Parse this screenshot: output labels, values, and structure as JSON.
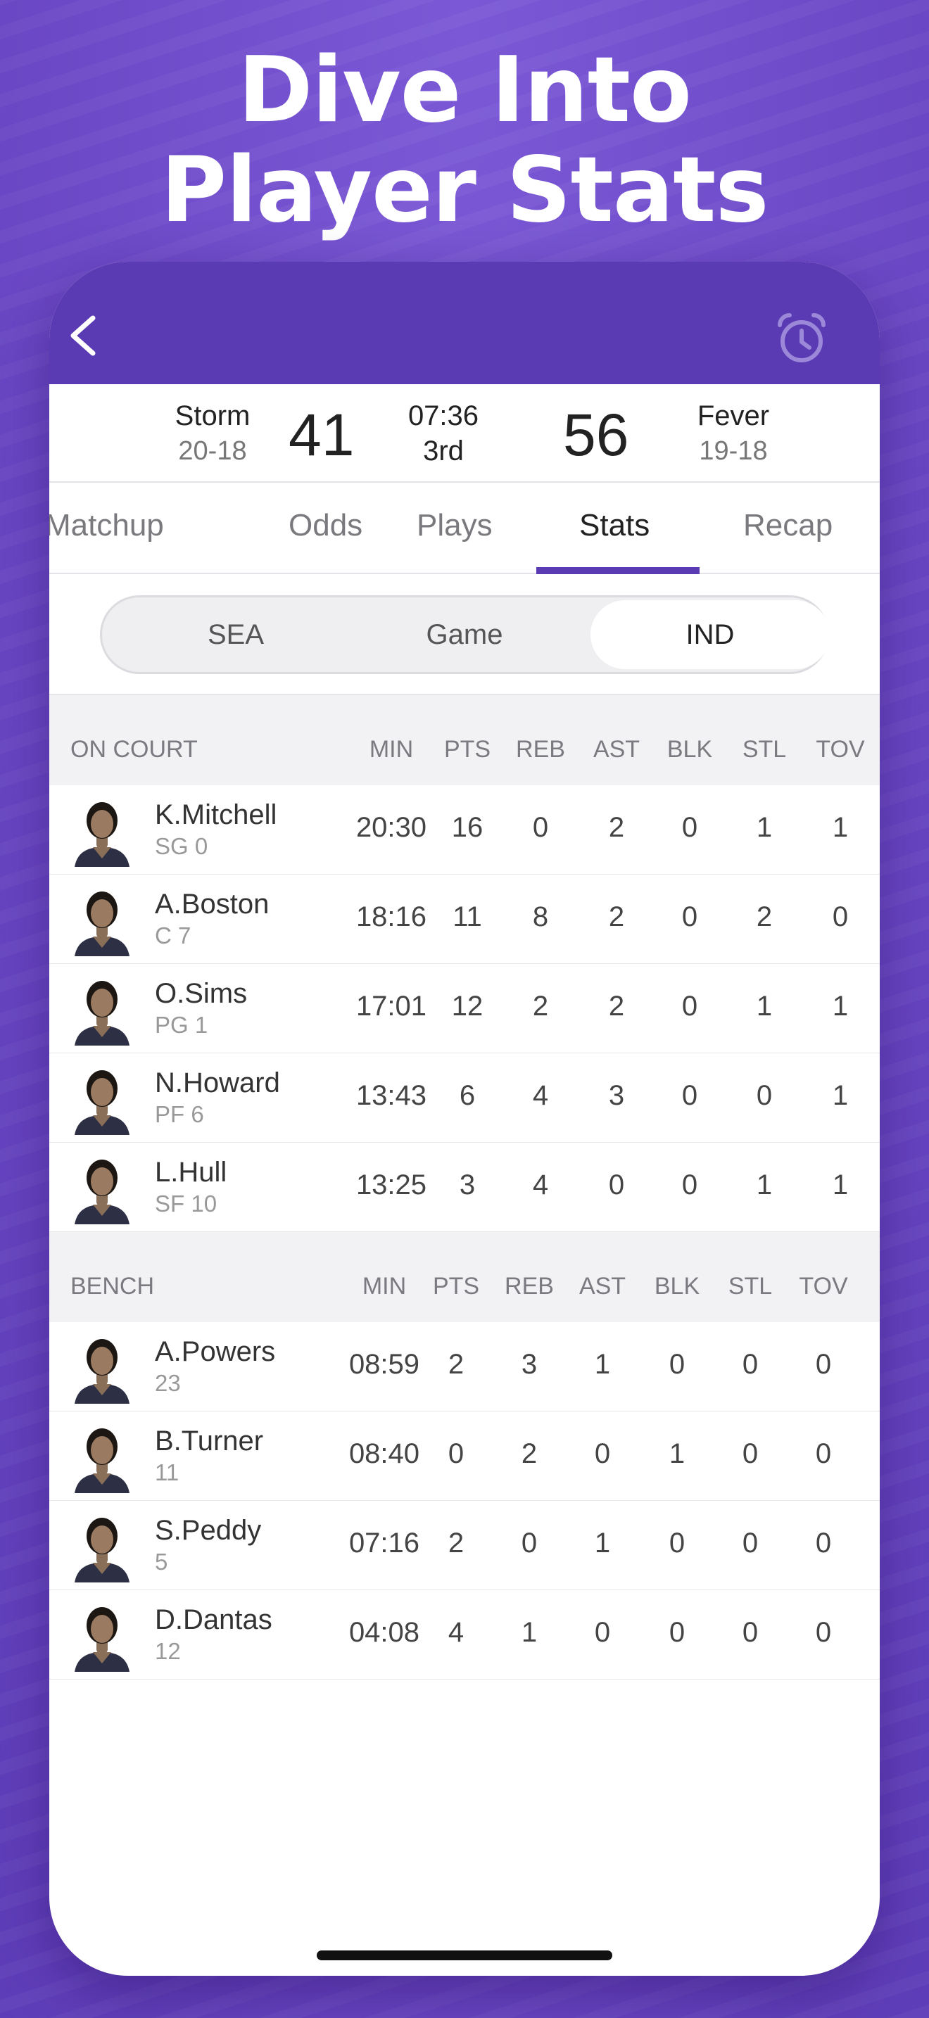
{
  "headline": {
    "line1": "Dive Into",
    "line2": "Player Stats"
  },
  "score": {
    "away_team": "Storm",
    "away_record": "20-18",
    "away_points": "41",
    "clock": "07:36",
    "period": "3rd",
    "home_points": "56",
    "home_team": "Fever",
    "home_record": "19-18"
  },
  "tabs": [
    "Matchup",
    "Odds",
    "Plays",
    "Stats",
    "Recap"
  ],
  "segment": [
    "SEA",
    "Game",
    "IND"
  ],
  "columns": [
    "MIN",
    "PTS",
    "REB",
    "AST",
    "BLK",
    "STL",
    "TOV"
  ],
  "on_court": {
    "title": "ON COURT",
    "players": [
      {
        "name": "K.Mitchell",
        "pos": "SG 0",
        "stats": [
          "20:30",
          "16",
          "0",
          "2",
          "0",
          "1",
          "1"
        ]
      },
      {
        "name": "A.Boston",
        "pos": "C 7",
        "stats": [
          "18:16",
          "11",
          "8",
          "2",
          "0",
          "2",
          "0"
        ]
      },
      {
        "name": "O.Sims",
        "pos": "PG 1",
        "stats": [
          "17:01",
          "12",
          "2",
          "2",
          "0",
          "1",
          "1"
        ]
      },
      {
        "name": "N.Howard",
        "pos": "PF 6",
        "stats": [
          "13:43",
          "6",
          "4",
          "3",
          "0",
          "0",
          "1"
        ]
      },
      {
        "name": "L.Hull",
        "pos": "SF 10",
        "stats": [
          "13:25",
          "3",
          "4",
          "0",
          "0",
          "1",
          "1"
        ]
      }
    ]
  },
  "bench": {
    "title": "BENCH",
    "players": [
      {
        "name": "A.Powers",
        "pos": "23",
        "stats": [
          "08:59",
          "2",
          "3",
          "1",
          "0",
          "0",
          "0"
        ]
      },
      {
        "name": "B.Turner",
        "pos": "11",
        "stats": [
          "08:40",
          "0",
          "2",
          "0",
          "1",
          "0",
          "0"
        ]
      },
      {
        "name": "S.Peddy",
        "pos": "5",
        "stats": [
          "07:16",
          "2",
          "0",
          "1",
          "0",
          "0",
          "0"
        ]
      },
      {
        "name": "D.Dantas",
        "pos": "12",
        "stats": [
          "04:08",
          "4",
          "1",
          "0",
          "0",
          "0",
          "0"
        ]
      }
    ]
  },
  "colors": {
    "brand_purple": "#5b3bb3",
    "background_purple": "#7250cc"
  },
  "icons": {
    "back": "chevron-left-icon",
    "alarm": "alarm-clock-icon",
    "avatar": "player-headshot-icon"
  }
}
